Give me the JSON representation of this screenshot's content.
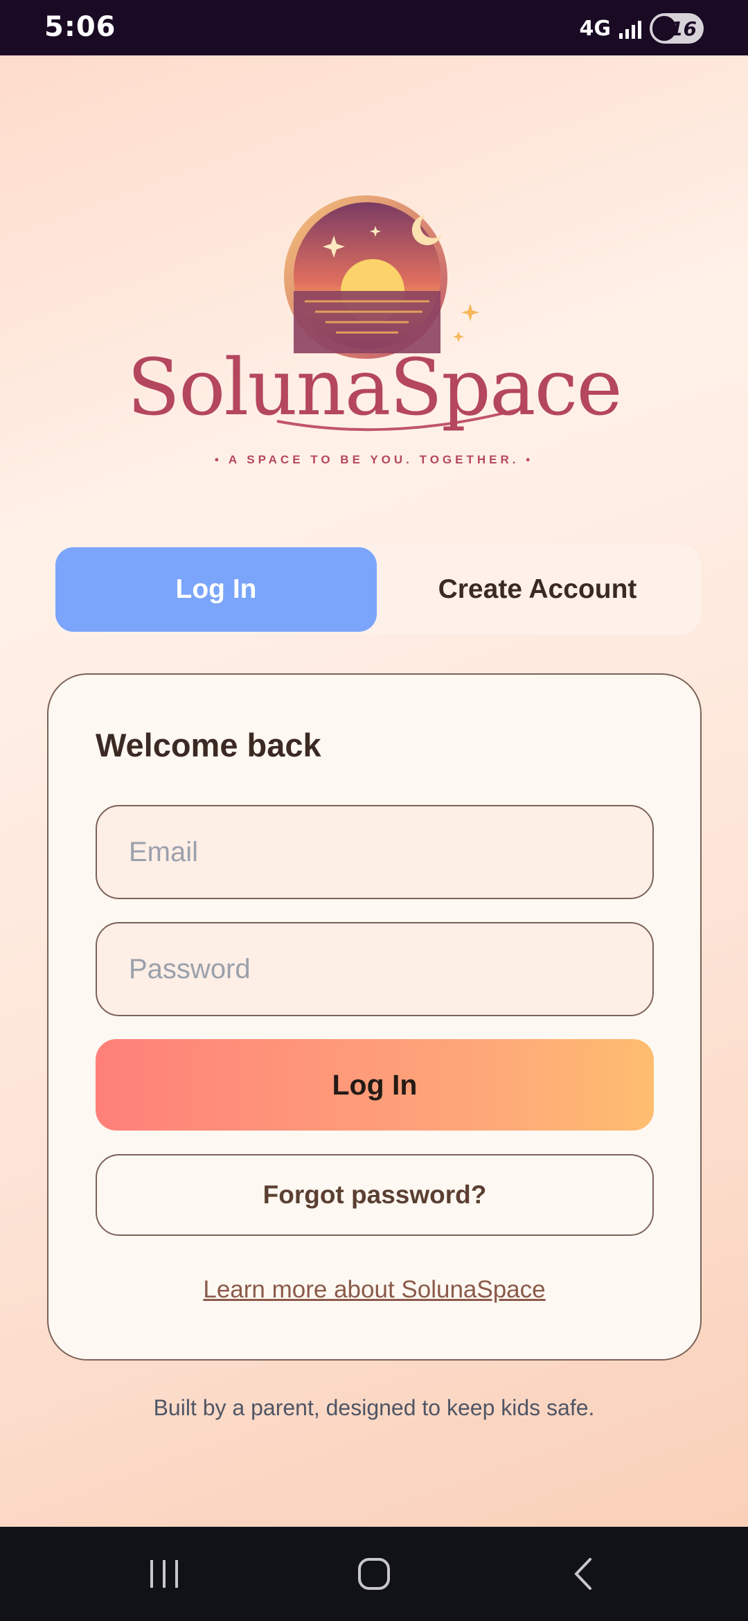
{
  "status_bar": {
    "time": "5:06",
    "network": "4G",
    "battery": "16"
  },
  "brand": {
    "name": "SolunaSpace",
    "tagline": "• A SPACE TO BE YOU. TOGETHER. •"
  },
  "tabs": [
    {
      "label": "Log In",
      "active": true
    },
    {
      "label": "Create Account",
      "active": false
    }
  ],
  "login_card": {
    "title": "Welcome back",
    "email_placeholder": "Email",
    "password_placeholder": "Password",
    "login_button": "Log In",
    "forgot_button": "Forgot password?",
    "learn_more_link": "Learn more about SolunaSpace"
  },
  "footer_note": "Built by a parent, designed to keep kids safe.",
  "colors": {
    "tab_active": "#7aa5fb",
    "button_gradient_start": "#fe8079",
    "button_gradient_end": "#fdbd6f",
    "brand": "#b4465e"
  },
  "icons": {
    "nav_recents": "recents-icon",
    "nav_home": "home-icon",
    "nav_back": "back-icon"
  }
}
